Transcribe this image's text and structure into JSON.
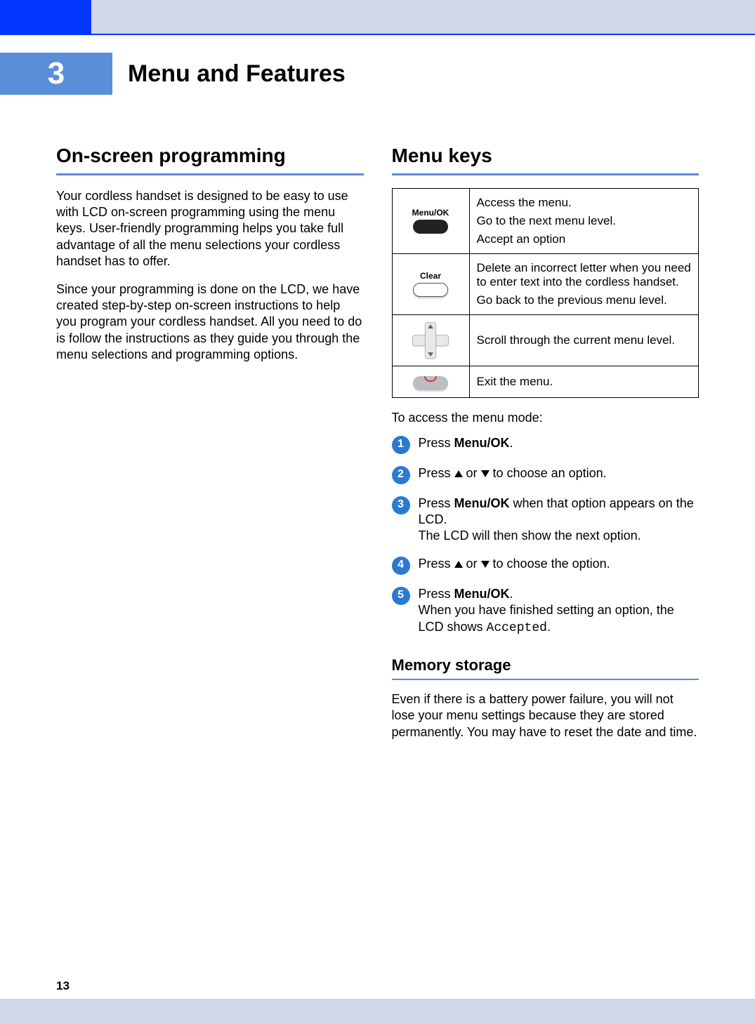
{
  "chapter": {
    "number": "3",
    "title": "Menu and Features"
  },
  "left": {
    "heading": "On-screen programming",
    "p1": "Your cordless handset is designed to be easy to use with LCD on-screen programming using the menu keys. User-friendly programming helps you take full advantage of all the menu selections your cordless handset has to offer.",
    "p2": "Since your programming is done on the LCD, we have created step-by-step on-screen instructions to help you program your cordless handset. All you need to do is follow the instructions as they guide you through the menu selections and programming options."
  },
  "right": {
    "heading": "Menu keys",
    "table": [
      {
        "icon_label": "Menu/OK",
        "lines": [
          "Access the menu.",
          "Go to the next menu level.",
          "Accept an option"
        ]
      },
      {
        "icon_label": "Clear",
        "lines": [
          "Delete an incorrect letter when you need to enter text into the cordless handset.",
          "Go back to the previous menu level."
        ]
      },
      {
        "icon_label": "dpad",
        "lines": [
          "Scroll through the current menu level."
        ]
      },
      {
        "icon_label": "end",
        "lines": [
          "Exit the menu."
        ]
      }
    ],
    "access_intro": "To access the menu mode:",
    "steps": {
      "s1_a": "Press ",
      "s1_b": "Menu/OK",
      "s1_c": ".",
      "s2_a": "Press ",
      "s2_b": " or ",
      "s2_c": " to choose an option.",
      "s3_a": "Press ",
      "s3_b": "Menu/OK",
      "s3_c": " when that option appears on the LCD.",
      "s3_d": "The LCD will then show the next option.",
      "s4_a": "Press ",
      "s4_b": " or ",
      "s4_c": " to choose the option.",
      "s5_a": "Press ",
      "s5_b": "Menu/OK",
      "s5_c": ".",
      "s5_d": "When you have finished setting an option, the LCD shows ",
      "s5_e": "Accepted",
      "s5_f": "."
    },
    "memory_heading": "Memory storage",
    "memory_body": "Even if there is a battery power failure, you will not lose your menu settings because they are stored permanently. You may have to reset the date and time."
  },
  "page_number": "13"
}
